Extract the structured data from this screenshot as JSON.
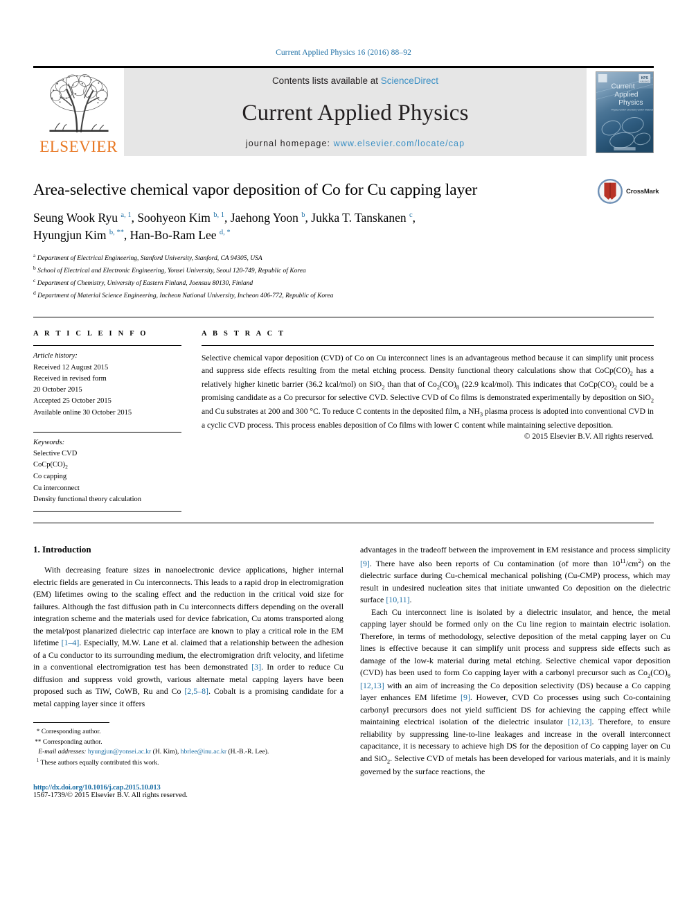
{
  "running_head": "Current Applied Physics 16 (2016) 88–92",
  "masthead": {
    "publisher_logo_text": "ELSEVIER",
    "contents_prefix": "Contents lists available at ",
    "contents_link": "ScienceDirect",
    "journal_name": "Current Applied Physics",
    "homepage_prefix": "journal homepage: ",
    "homepage_url": "www.elsevier.com/locate/cap",
    "cover": {
      "line1": "Current",
      "line2": "Applied",
      "line3": "Physics",
      "badge": "KPS",
      "tagline": "Physics · Chemistry · Materials Science"
    }
  },
  "article": {
    "title": "Area-selective chemical vapor deposition of Co for Cu capping layer",
    "crossmark_label": "CrossMark",
    "authors_line1": "Seung Wook Ryu ",
    "authors": [
      {
        "name": "Seung Wook Ryu",
        "marks": "a, 1"
      },
      {
        "name": "Soohyeon Kim",
        "marks": "b, 1"
      },
      {
        "name": "Jaehong Yoon",
        "marks": "b"
      },
      {
        "name": "Jukka T. Tanskanen",
        "marks": "c"
      },
      {
        "name": "Hyungjun Kim",
        "marks": "b, **"
      },
      {
        "name": "Han-Bo-Ram Lee",
        "marks": "d, *"
      }
    ],
    "affiliations": [
      {
        "mark": "a",
        "text": "Department of Electrical Engineering, Stanford University, Stanford, CA 94305, USA"
      },
      {
        "mark": "b",
        "text": "School of Electrical and Electronic Engineering, Yonsei University, Seoul 120-749, Republic of Korea"
      },
      {
        "mark": "c",
        "text": "Department of Chemistry, University of Eastern Finland, Joensuu 80130, Finland"
      },
      {
        "mark": "d",
        "text": "Department of Material Science Engineering, Incheon National University, Incheon 406-772, Republic of Korea"
      }
    ]
  },
  "article_info": {
    "heading": "A R T I C L E   I N F O",
    "history_label": "Article history:",
    "history": [
      "Received 12 August 2015",
      "Received in revised form",
      "20 October 2015",
      "Accepted 25 October 2015",
      "Available online 30 October 2015"
    ],
    "keywords_label": "Keywords:",
    "keywords": [
      "Selective CVD",
      "CoCp(CO)2",
      "Co capping",
      "Cu interconnect",
      "Density functional theory calculation"
    ]
  },
  "abstract": {
    "heading": "A B S T R A C T",
    "body_parts": [
      "Selective chemical vapor deposition (CVD) of Co on Cu interconnect lines is an advantageous method because it can simplify unit process and suppress side effects resulting from the metal etching process. Density functional theory calculations show that CoCp(CO)",
      "2",
      " has a relatively higher kinetic barrier (36.2 kcal/mol) on SiO",
      "2",
      " than that of Co",
      "2",
      "(CO)",
      "8",
      " (22.9 kcal/mol). This indicates that CoCp(CO)",
      "2",
      " could be a promising candidate as a Co precursor for selective CVD. Selective CVD of Co films is demonstrated experimentally by deposition on SiO",
      "2",
      " and Cu substrates at 200 and 300 °C. To reduce C contents in the deposited film, a NH",
      "3",
      " plasma process is adopted into conventional CVD in a cyclic CVD process. This process enables deposition of Co films with lower C content while maintaining selective deposition."
    ],
    "copyright": "© 2015 Elsevier B.V. All rights reserved."
  },
  "body": {
    "section_number_title": "1. Introduction",
    "left_paragraphs": [
      "With decreasing feature sizes in nanoelectronic device applications, higher internal electric fields are generated in Cu interconnects. This leads to a rapid drop in electromigration (EM) lifetimes owing to the scaling effect and the reduction in the critical void size for failures. Although the fast diffusion path in Cu interconnects differs depending on the overall integration scheme and the materials used for device fabrication, Cu atoms transported along the metal/post planarized dielectric cap interface are known to play a critical role in the EM lifetime [1–4]. Especially, M.W. Lane et al. claimed that a relationship between the adhesion of a Cu conductor to its surrounding medium, the electromigration drift velocity, and lifetime in a conventional electromigration test has been demonstrated [3]. In order to reduce Cu diffusion and suppress void growth, various alternate metal capping layers have been proposed such as TiW, CoWB, Ru and Co [2,5–8]. Cobalt is a promising candidate for a metal capping layer since it offers"
    ],
    "right_paragraphs": [
      "advantages in the tradeoff between the improvement in EM resistance and process simplicity [9]. There have also been reports of Cu contamination (of more than 10^11/cm^2) on the dielectric surface during Cu-chemical mechanical polishing (Cu-CMP) process, which may result in undesired nucleation sites that initiate unwanted Co deposition on the dielectric surface [10,11].",
      "Each Cu interconnect line is isolated by a dielectric insulator, and hence, the metal capping layer should be formed only on the Cu line region to maintain electric isolation. Therefore, in terms of methodology, selective deposition of the metal capping layer on Cu lines is effective because it can simplify unit process and suppress side effects such as damage of the low-k material during metal etching. Selective chemical vapor deposition (CVD) has been used to form Co capping layer with a carbonyl precursor such as Co2(CO)8 [12,13] with an aim of increasing the Co deposition selectivity (DS) because a Co capping layer enhances EM lifetime [9]. However, CVD Co processes using such Co-containing carbonyl precursors does not yield sufficient DS for achieving the capping effect while maintaining electrical isolation of the dielectric insulator [12,13]. Therefore, to ensure reliability by suppressing line-to-line leakages and increase in the overall interconnect capacitance, it is necessary to achieve high DS for the deposition of Co capping layer on Cu and SiO2. Selective CVD of metals has been developed for various materials, and it is mainly governed by the surface reactions, the"
    ]
  },
  "footnotes": {
    "corresponding_1": "Corresponding author.",
    "corresponding_2": "Corresponding author.",
    "email_label": "E-mail addresses:",
    "email_1": "hyungjun@yonsei.ac.kr",
    "email_1_owner": "(H. Kim),",
    "email_2": "hbrlee@inu.ac.kr",
    "email_2_owner": "(H.-B.-R. Lee).",
    "equal_contrib_mark": "1",
    "equal_contrib": "These authors equally contributed this work.",
    "doi": "http://dx.doi.org/10.1016/j.cap.2015.10.013",
    "issn_line": "1567-1739/© 2015 Elsevier B.V. All rights reserved."
  },
  "colors": {
    "link_blue": "#1d6fa5",
    "sd_blue": "#3a8fc4",
    "elsevier_orange": "#e87722",
    "masthead_gray": "#e6e6e6"
  }
}
